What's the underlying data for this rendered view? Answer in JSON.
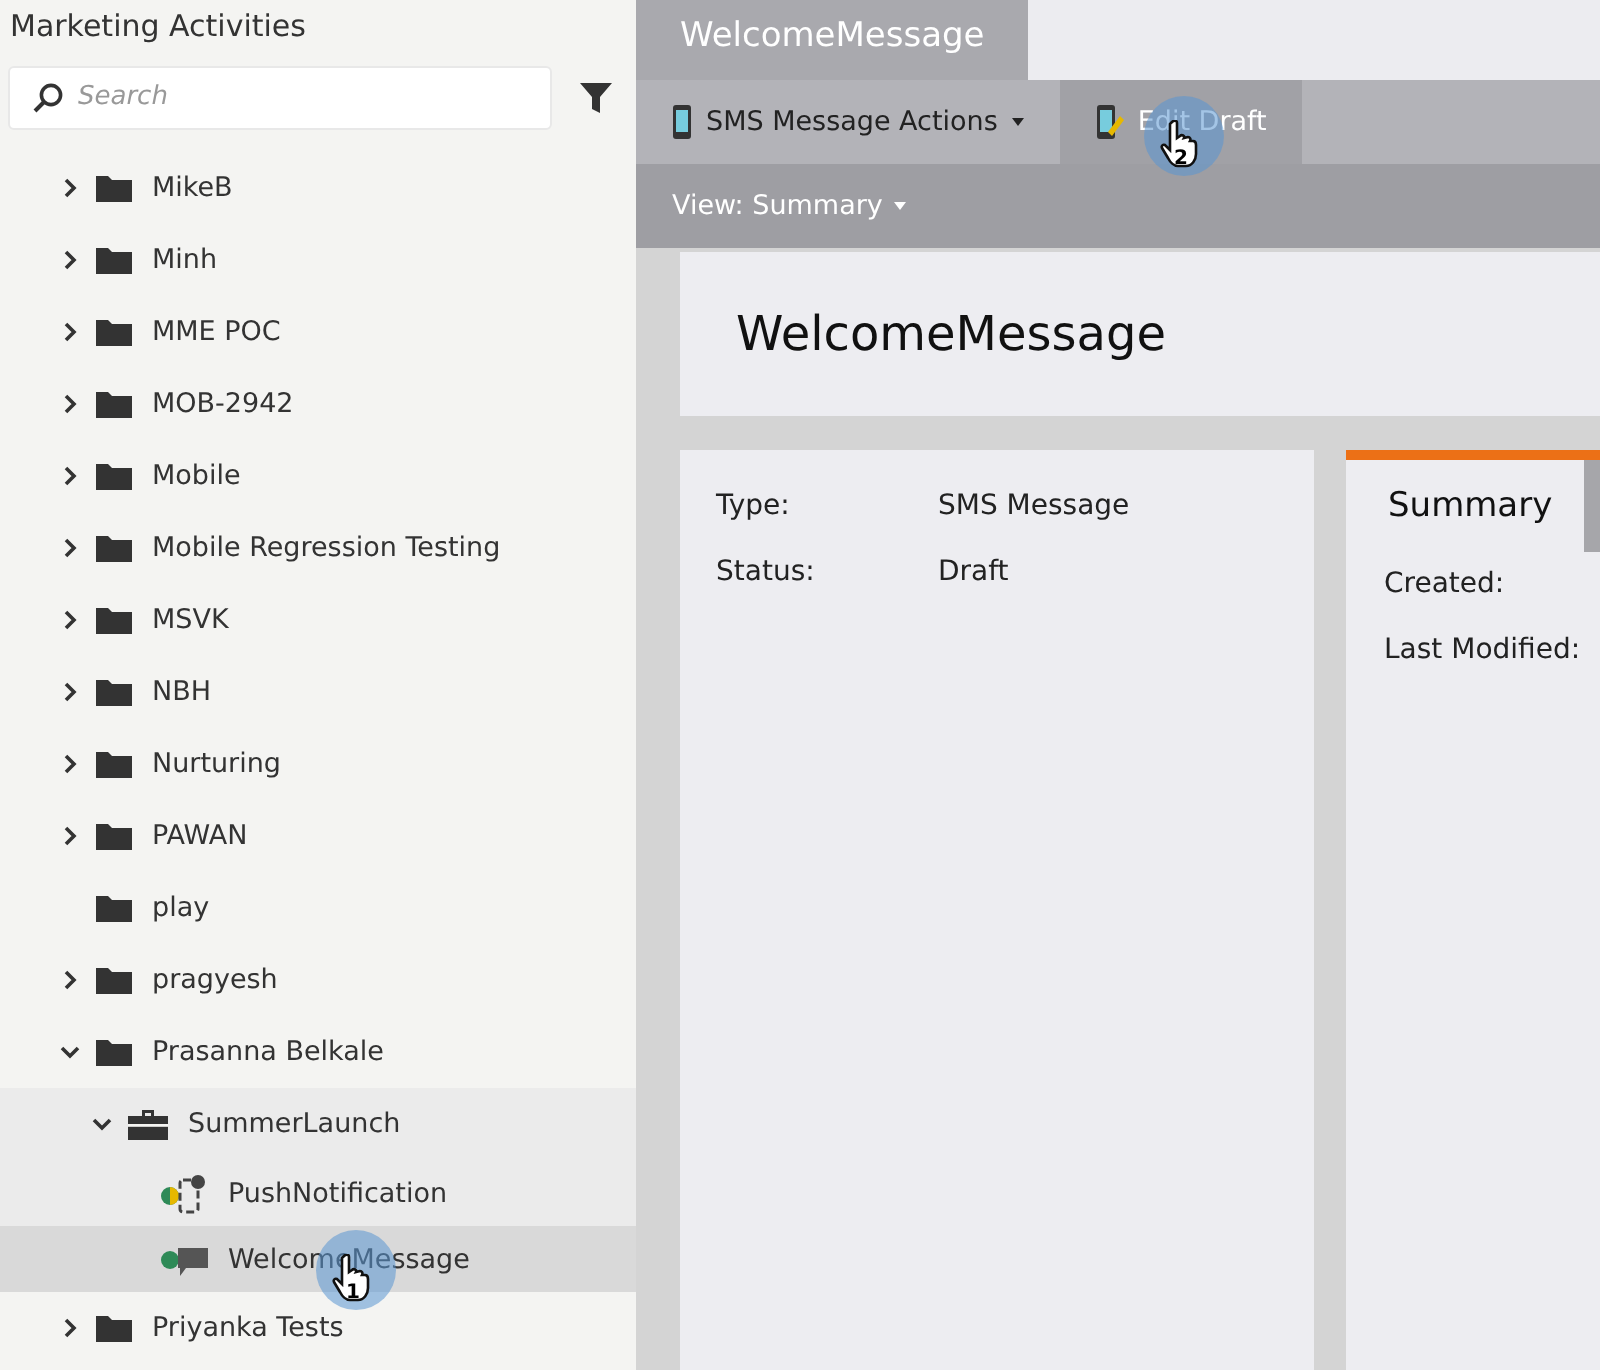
{
  "sidebar": {
    "title": "Marketing Activities",
    "search": {
      "placeholder": "Search"
    },
    "tree": [
      {
        "label": "MikeB",
        "kind": "folder",
        "expanded": false,
        "selected": false
      },
      {
        "label": "Minh",
        "kind": "folder",
        "expanded": false,
        "selected": false
      },
      {
        "label": "MME POC",
        "kind": "folder",
        "expanded": false,
        "selected": false
      },
      {
        "label": "MOB-2942",
        "kind": "folder",
        "expanded": false,
        "selected": false
      },
      {
        "label": "Mobile",
        "kind": "folder",
        "expanded": false,
        "selected": false
      },
      {
        "label": "Mobile Regression Testing",
        "kind": "folder",
        "expanded": false,
        "selected": false
      },
      {
        "label": "MSVK",
        "kind": "folder",
        "expanded": false,
        "selected": false
      },
      {
        "label": "NBH",
        "kind": "folder",
        "expanded": false,
        "selected": false
      },
      {
        "label": "Nurturing",
        "kind": "folder",
        "expanded": false,
        "selected": false
      },
      {
        "label": "PAWAN",
        "kind": "folder",
        "expanded": false,
        "selected": false
      },
      {
        "label": "play",
        "kind": "folder",
        "selected": false
      },
      {
        "label": "pragyesh",
        "kind": "folder",
        "expanded": false,
        "selected": false
      },
      {
        "label": "Prasanna Belkale",
        "kind": "folder",
        "expanded": true,
        "selected": false,
        "children": [
          {
            "label": "SummerLaunch",
            "kind": "program",
            "expanded": true,
            "selected": false,
            "children": [
              {
                "label": "PushNotification",
                "kind": "push",
                "selected": false
              },
              {
                "label": "WelcomeMessage",
                "kind": "sms",
                "selected": true,
                "step": "1"
              }
            ]
          }
        ]
      },
      {
        "label": "Priyanka Tests",
        "kind": "folder",
        "expanded": false,
        "selected": false
      }
    ]
  },
  "tabs": [
    {
      "label": "WelcomeMessage",
      "selected": true
    }
  ],
  "toolbar": [
    {
      "label": "SMS Message Actions",
      "kind": "menu",
      "selected": false
    },
    {
      "label": "Edit Draft",
      "kind": "edit",
      "selected": true,
      "step": "2"
    }
  ],
  "view_menu": "View: Summary",
  "heading": "WelcomeMessage",
  "details": [
    {
      "label": "Type:",
      "value": "SMS Message"
    },
    {
      "label": "Status:",
      "value": "Draft"
    }
  ],
  "summary_panel": {
    "tab": "Summary",
    "fields": [
      "Created:",
      "Last Modified:"
    ]
  }
}
